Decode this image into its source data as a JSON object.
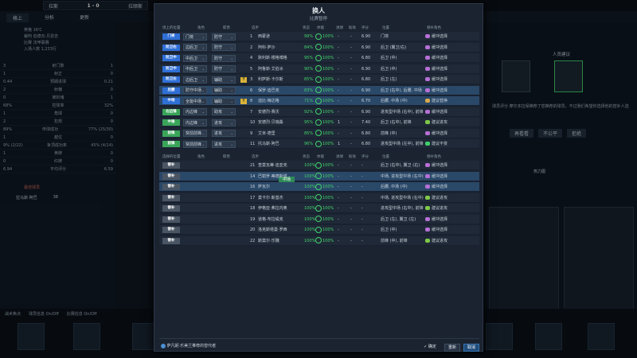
{
  "background": {
    "match": {
      "home": "拉斯",
      "away": "拉顺斯",
      "score": "1 - 0"
    },
    "nav": {
      "back": "格上",
      "analysis": "分析",
      "hint": "更新"
    },
    "left_info": {
      "line1": "英格 16'C",
      "line2": "裁判 伯德瓦·贝恩吉",
      "line3": "比赛 法甲联赛",
      "line4": "入场人数 1,233行"
    },
    "stats": [
      {
        "home": "3",
        "label": "射门数",
        "away": "1"
      },
      {
        "home": "1",
        "label": "射正",
        "away": "0"
      },
      {
        "home": "0.44",
        "label": "预期进球",
        "away": "0.21"
      },
      {
        "home": "2",
        "label": "射偏",
        "away": "0"
      },
      {
        "home": "0",
        "label": "被封堵",
        "away": "1"
      },
      {
        "home": "68%",
        "label": "控球率",
        "away": "32%"
      },
      {
        "home": "1",
        "label": "角球",
        "away": "0"
      },
      {
        "home": "2",
        "label": "犯规",
        "away": "0"
      },
      {
        "home": "89%",
        "label": "传球成功",
        "away": "77% (25/30)"
      },
      {
        "home": "1",
        "label": "越位",
        "away": "0"
      },
      {
        "home": "9% (2/22)",
        "label": "争顶成功率",
        "away": "45% (4/14)"
      },
      {
        "home": "1",
        "label": "黄牌",
        "away": "0"
      },
      {
        "home": "0",
        "label": "红牌",
        "away": "0"
      },
      {
        "home": "6.94",
        "label": "平均评分",
        "away": "6.59"
      }
    ],
    "best_player_title": "最佳球员",
    "best_player": {
      "name": "拉马斯·阿巴",
      "rating": "38"
    },
    "right_title": "人员建议",
    "right_text": "球员评分·摩尔本拉保推荐了您推荐的球员，不过我们希望你选择他的替补人选",
    "right_buttons": [
      "再看看",
      "不公平",
      "拒绝"
    ],
    "formation_title": "热力图",
    "bottom_toggles": [
      "战术焦点",
      "球员信息 On/Off",
      "比赛信息 On/Off"
    ]
  },
  "modal": {
    "title": "换人",
    "subtitle": "比赛暂停",
    "header_top": [
      "场上的位置",
      "角色",
      "职责",
      "",
      "选手",
      "状态",
      "体能",
      "进球",
      "助攻",
      "评分",
      "位置",
      "替补角色"
    ],
    "header_bottom": [
      "选择的位置",
      "角色",
      "职责",
      "",
      "选手",
      "状态",
      "体能",
      "进球",
      "助攻",
      "评分",
      "位置",
      "替补角色"
    ],
    "starters": [
      {
        "pos": "门将",
        "pos_color": "#2f6fd6",
        "role": "门将",
        "duty": "防守",
        "badge": "",
        "num": "1",
        "name": "西蒙逊",
        "cond": "99%",
        "fit": "100%",
        "goals": "-",
        "assists": "-",
        "rating": "6.90",
        "position": "门将",
        "sub_role": "缓冲选择",
        "sub_color": "#b66fd6",
        "hl": false
      },
      {
        "pos": "防卫右",
        "pos_color": "#2f6fd6",
        "role": "边后卫",
        "duty": "防守",
        "badge": "",
        "num": "2",
        "name": "阿科·萨沙",
        "cond": "84%",
        "fit": "100%",
        "goals": "-",
        "assists": "-",
        "rating": "6.90",
        "position": "后卫 (翼卫/右)",
        "sub_role": "缓冲选择",
        "sub_color": "#b66fd6",
        "hl": false
      },
      {
        "pos": "防卫中",
        "pos_color": "#2f6fd6",
        "role": "中后卫",
        "duty": "防守",
        "badge": "",
        "num": "4",
        "name": "默利斯·楼格博格",
        "cond": "95%",
        "fit": "100%",
        "goals": "-",
        "assists": "-",
        "rating": "6.80",
        "position": "后卫 (中)",
        "sub_role": "缓冲选择",
        "sub_color": "#b66fd6",
        "hl": false
      },
      {
        "pos": "防卫中",
        "pos_color": "#2f6fd6",
        "role": "中后卫",
        "duty": "防守",
        "badge": "",
        "num": "5",
        "name": "阿鲁斯·艾伯冰",
        "cond": "90%",
        "fit": "100%",
        "goals": "-",
        "assists": "-",
        "rating": "6.90",
        "position": "后卫 (中)",
        "sub_role": "缓冲选择",
        "sub_color": "#b66fd6",
        "hl": false
      },
      {
        "pos": "防卫左",
        "pos_color": "#2f6fd6",
        "role": "边后卫",
        "duty": "辅助",
        "badge": "Y",
        "num": "3",
        "name": "利萨斯·卡尔斯",
        "cond": "85%",
        "fit": "100%",
        "goals": "-",
        "assists": "-",
        "rating": "6.80",
        "position": "后卫 (左)",
        "sub_role": "缓冲选择",
        "sub_color": "#b66fd6",
        "hl": false
      },
      {
        "pos": "后腰",
        "pos_color": "#2f6fd6",
        "role": "防守中场",
        "duty": "辅助",
        "badge": "",
        "num": "6",
        "name": "保罗·迪巴克",
        "cond": "83%",
        "fit": "100%",
        "goals": "-",
        "assists": "-",
        "rating": "6.90",
        "position": "后卫 (右中), 后腰, 中场",
        "sub_role": "缓冲选择",
        "sub_color": "#b66fd6",
        "hl": true
      },
      {
        "pos": "中场",
        "pos_color": "#2f6fd6",
        "role": "全能中场",
        "duty": "辅助",
        "badge": "Y",
        "num": "8",
        "name": "迪比·梅达格",
        "cond": "71%",
        "fit": "100%",
        "goals": "-",
        "assists": "-",
        "rating": "6.70",
        "position": "后腰, 中场 (中)",
        "sub_role": "建议替换",
        "sub_color": "#d6a84a",
        "hl": true
      },
      {
        "pos": "右边锋",
        "pos_color": "#3aa55a",
        "role": "内边锋",
        "duty": "助攻",
        "badge": "",
        "num": "7",
        "name": "安德烈·赛沃",
        "cond": "92%",
        "fit": "100%",
        "goals": "-",
        "assists": "-",
        "rating": "6.90",
        "position": "进攻型中场 (右中), 前锋",
        "sub_role": "缓冲选择",
        "sub_color": "#b66fd6",
        "hl": false
      },
      {
        "pos": "中锋",
        "pos_color": "#3aa55a",
        "role": "内边锋",
        "duty": "进攻",
        "badge": "",
        "num": "10",
        "name": "安德烈·贝瑞桑",
        "cond": "95%",
        "fit": "100%",
        "goals": "1",
        "assists": "-",
        "rating": "7.40",
        "position": "后卫 (右中), 前锋",
        "sub_role": "建议进攻",
        "sub_color": "#7fc84a",
        "hl": false
      },
      {
        "pos": "前锋",
        "pos_color": "#3aa55a",
        "role": "突前前锋",
        "duty": "进攻",
        "badge": "",
        "num": "9",
        "name": "艾米·德里",
        "cond": "85%",
        "fit": "100%",
        "goals": "-",
        "assists": "-",
        "rating": "6.80",
        "position": "前锋 (中)",
        "sub_role": "缓冲选择",
        "sub_color": "#b66fd6",
        "hl": false
      },
      {
        "pos": "前锋",
        "pos_color": "#3aa55a",
        "role": "突前前锋",
        "duty": "进攻",
        "badge": "",
        "num": "11",
        "name": "托马斯·阿巴",
        "cond": "96%",
        "fit": "100%",
        "goals": "1",
        "assists": "-",
        "rating": "6.80",
        "position": "进攻型中场 (左中), 前锋",
        "sub_role": "建议不变",
        "sub_color": "#3fcf6a",
        "hl": false
      }
    ],
    "subs": [
      {
        "pos": "替补",
        "name": "查莫瓦蒂·迪亚克",
        "num": "21",
        "cond": "100%",
        "fit": "100%",
        "goals": "-",
        "assists": "-",
        "rating": "-",
        "position": "后卫 (右中), 翼卫 (右)",
        "sub_role": "缓冲选择",
        "sub_color": "#b66fd6",
        "hl": false,
        "drag": ""
      },
      {
        "pos": "替补",
        "name": "巴勒罗·蒂德斯塔",
        "num": "14",
        "cond": "100%",
        "fit": "100%",
        "goals": "-",
        "assists": "-",
        "rating": "-",
        "position": "中场, 进攻型中场 (右中)",
        "sub_role": "缓冲选择",
        "sub_color": "#b66fd6",
        "hl": true,
        "drag": "中场"
      },
      {
        "pos": "替补",
        "name": "萨瓦尔",
        "num": "16",
        "cond": "100%",
        "fit": "100%",
        "goals": "-",
        "assists": "-",
        "rating": "-",
        "position": "后腰, 中场 (中)",
        "sub_role": "缓冲选择",
        "sub_color": "#b66fd6",
        "hl": true,
        "drag": ""
      },
      {
        "pos": "替补",
        "name": "莫卡尔·斯基杰",
        "num": "17",
        "cond": "100%",
        "fit": "100%",
        "goals": "-",
        "assists": "-",
        "rating": "-",
        "position": "中场, 进攻型中场 (右中)",
        "sub_role": "建议进攻",
        "sub_color": "#7fc84a",
        "hl": false,
        "drag": ""
      },
      {
        "pos": "替补",
        "name": "伊格亚·弗拉内奥",
        "num": "18",
        "cond": "100%",
        "fit": "100%",
        "goals": "-",
        "assists": "-",
        "rating": "-",
        "position": "进攻型中场 (右中), 前锋",
        "sub_role": "建议进攻",
        "sub_color": "#7fc84a",
        "hl": false,
        "drag": ""
      },
      {
        "pos": "替补",
        "name": "道格·布拉缇克",
        "num": "19",
        "cond": "100%",
        "fit": "100%",
        "goals": "-",
        "assists": "-",
        "rating": "-",
        "position": "后卫 (左), 翼卫 (左)",
        "sub_role": "缓冲选择",
        "sub_color": "#b66fd6",
        "hl": false,
        "drag": ""
      },
      {
        "pos": "替补",
        "name": "洛克斯塔曼·罗西",
        "num": "20",
        "cond": "100%",
        "fit": "100%",
        "goals": "-",
        "assists": "-",
        "rating": "-",
        "position": "后卫 (中)",
        "sub_role": "缓冲选择",
        "sub_color": "#b66fd6",
        "hl": false,
        "drag": ""
      },
      {
        "pos": "替补",
        "name": "斯莫尔·乐魏",
        "num": "22",
        "cond": "100%",
        "fit": "100%",
        "goals": "-",
        "assists": "-",
        "rating": "-",
        "position": "前锋 (中), 前锋",
        "sub_role": "建议进攻",
        "sub_color": "#7fc84a",
        "hl": false,
        "drag": ""
      }
    ],
    "footer_note": "萨凡妮·乐美兰推荐的替代者",
    "confirm_label": "✓ 确定",
    "reset_label": "重新",
    "cancel_label": "取消"
  }
}
